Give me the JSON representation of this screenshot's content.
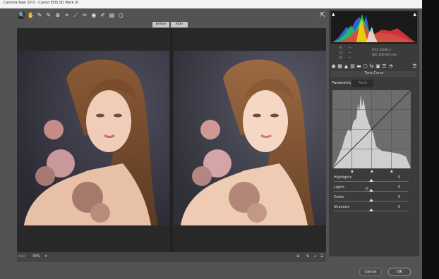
{
  "window": {
    "title": "Camera Raw 10.0 - Canon EOS 5D Mark III",
    "app_icon": "camera-raw-icon"
  },
  "toolbar": {
    "tools": [
      {
        "name": "zoom-tool-icon",
        "glyph": "🔍"
      },
      {
        "name": "hand-tool-icon",
        "glyph": "✋"
      },
      {
        "name": "white-balance-tool-icon",
        "glyph": "✎"
      },
      {
        "name": "color-sampler-tool-icon",
        "glyph": "✎"
      },
      {
        "name": "targeted-adjustment-tool-icon",
        "glyph": "⊕"
      },
      {
        "name": "crop-tool-icon",
        "glyph": "⌗"
      },
      {
        "name": "straighten-tool-icon",
        "glyph": "⟋"
      },
      {
        "name": "spot-removal-tool-icon",
        "glyph": "✂"
      },
      {
        "name": "red-eye-tool-icon",
        "glyph": "◉"
      },
      {
        "name": "adjustment-brush-icon",
        "glyph": "✐"
      },
      {
        "name": "graduated-filter-icon",
        "glyph": "▤"
      },
      {
        "name": "radial-filter-icon",
        "glyph": "○"
      }
    ]
  },
  "compare": {
    "before_label": "Before",
    "after_label": "After"
  },
  "bottom_bar": {
    "zoom_value": "33%"
  },
  "readout": {
    "r_label": "R:",
    "g_label": "G:",
    "b_label": "B:",
    "r_value": "---",
    "g_value": "---",
    "b_value": "---",
    "aperture_shutter": "f/11   1/160 s",
    "iso_focal": "ISO 100   60 mm"
  },
  "panel": {
    "title": "Tone Curve",
    "tabs": [
      {
        "label": "Parametric",
        "active": true
      },
      {
        "label": "Point",
        "active": false
      }
    ],
    "sliders": [
      {
        "label": "Highlights",
        "value": "0",
        "level": 0.5
      },
      {
        "label": "Lights",
        "value": "0",
        "level": 0.5
      },
      {
        "label": "Darks",
        "value": "0",
        "level": 0.5
      },
      {
        "label": "Shadows",
        "value": "0",
        "level": 0.5
      }
    ]
  },
  "footer": {
    "cancel_label": "Cancel",
    "ok_label": "OK"
  },
  "colors": {
    "panel_bg": "#3b3b3b",
    "app_bg": "#535353",
    "title_bg": "#f3f3f3"
  }
}
